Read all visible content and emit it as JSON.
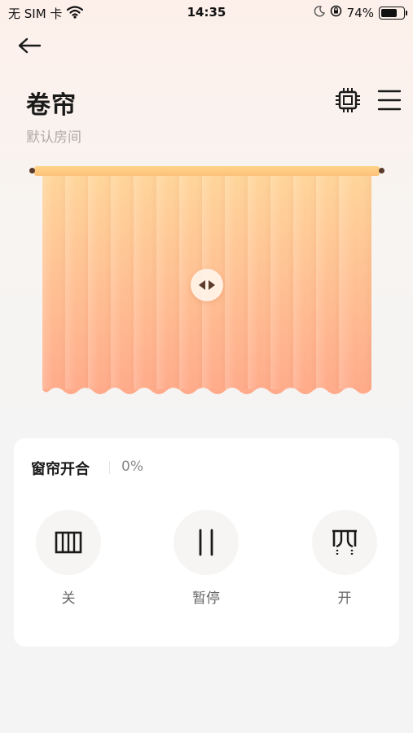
{
  "status": {
    "carrier": "无 SIM 卡",
    "time": "14:35",
    "battery_text": "74%",
    "battery_level": 0.74
  },
  "header": {
    "title": "卷帘",
    "subtitle": "默认房间"
  },
  "icons": {
    "back": "back-arrow-icon",
    "device": "chip-icon",
    "menu": "menu-icon",
    "drag": "drag-handle-icon"
  },
  "colors": {
    "curtain_top": "#ffd59a",
    "curtain_bottom": "#ffb08e",
    "rod": "#fbc27a",
    "rod_ends": "#5a3b2c"
  },
  "control": {
    "title": "窗帘开合",
    "value": "0%",
    "buttons": {
      "close_label": "关",
      "pause_label": "暂停",
      "open_label": "开"
    }
  }
}
